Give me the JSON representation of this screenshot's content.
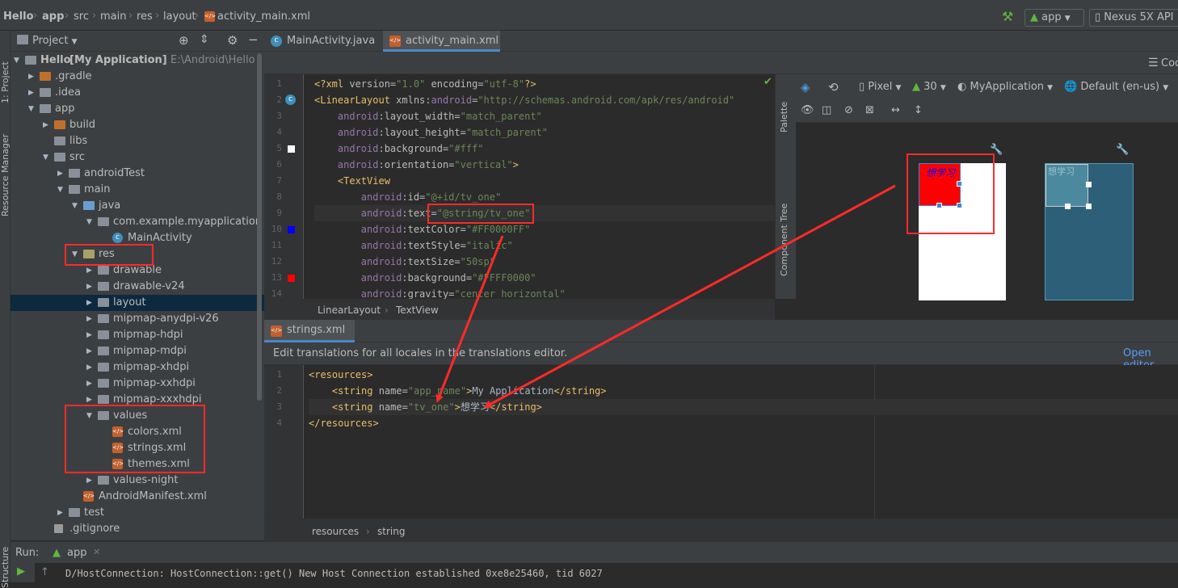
{
  "navbar": {
    "crumbs": [
      "Hello",
      "app",
      "src",
      "main",
      "res",
      "layout",
      "activity_main.xml"
    ],
    "run_config": "app",
    "device": "Nexus 5X API"
  },
  "left_stripe": {
    "project_label": "1: Project",
    "resource_manager_label": "Resource Manager",
    "structure_label": "Structure"
  },
  "project_panel": {
    "title": "Project",
    "tree": [
      {
        "label": "Hello",
        "extra": "[My Application]",
        "path": "E:\\Android\\Hello",
        "depth": 0,
        "arrow": "open",
        "icon": "folder"
      },
      {
        "label": ".gradle",
        "depth": 1,
        "arrow": "closed",
        "icon": "folder-orange"
      },
      {
        "label": ".idea",
        "depth": 1,
        "arrow": "closed",
        "icon": "folder"
      },
      {
        "label": "app",
        "depth": 1,
        "arrow": "open",
        "icon": "folder"
      },
      {
        "label": "build",
        "depth": 2,
        "arrow": "closed",
        "icon": "folder-orange"
      },
      {
        "label": "libs",
        "depth": 2,
        "arrow": "none",
        "icon": "folder"
      },
      {
        "label": "src",
        "depth": 2,
        "arrow": "open",
        "icon": "folder"
      },
      {
        "label": "androidTest",
        "depth": 3,
        "arrow": "closed",
        "icon": "folder"
      },
      {
        "label": "main",
        "depth": 3,
        "arrow": "open",
        "icon": "folder"
      },
      {
        "label": "java",
        "depth": 4,
        "arrow": "open",
        "icon": "folder-blue"
      },
      {
        "label": "com.example.myapplication",
        "depth": 5,
        "arrow": "open",
        "icon": "folder"
      },
      {
        "label": "MainActivity",
        "depth": 6,
        "arrow": "none",
        "icon": "class"
      },
      {
        "label": "res",
        "depth": 4,
        "arrow": "open",
        "icon": "folder-res"
      },
      {
        "label": "drawable",
        "depth": 5,
        "arrow": "closed",
        "icon": "folder"
      },
      {
        "label": "drawable-v24",
        "depth": 5,
        "arrow": "closed",
        "icon": "folder"
      },
      {
        "label": "layout",
        "depth": 5,
        "arrow": "closed",
        "icon": "folder",
        "selected": true
      },
      {
        "label": "mipmap-anydpi-v26",
        "depth": 5,
        "arrow": "closed",
        "icon": "folder"
      },
      {
        "label": "mipmap-hdpi",
        "depth": 5,
        "arrow": "closed",
        "icon": "folder"
      },
      {
        "label": "mipmap-mdpi",
        "depth": 5,
        "arrow": "closed",
        "icon": "folder"
      },
      {
        "label": "mipmap-xhdpi",
        "depth": 5,
        "arrow": "closed",
        "icon": "folder"
      },
      {
        "label": "mipmap-xxhdpi",
        "depth": 5,
        "arrow": "closed",
        "icon": "folder"
      },
      {
        "label": "mipmap-xxxhdpi",
        "depth": 5,
        "arrow": "closed",
        "icon": "folder"
      },
      {
        "label": "values",
        "depth": 5,
        "arrow": "open",
        "icon": "folder"
      },
      {
        "label": "colors.xml",
        "depth": 6,
        "arrow": "none",
        "icon": "xml"
      },
      {
        "label": "strings.xml",
        "depth": 6,
        "arrow": "none",
        "icon": "xml"
      },
      {
        "label": "themes.xml",
        "depth": 6,
        "arrow": "none",
        "icon": "xml"
      },
      {
        "label": "values-night",
        "depth": 5,
        "arrow": "closed",
        "icon": "folder"
      },
      {
        "label": "AndroidManifest.xml",
        "depth": 4,
        "arrow": "none",
        "icon": "manifest"
      },
      {
        "label": "test",
        "depth": 3,
        "arrow": "closed",
        "icon": "folder"
      },
      {
        "label": ".gitignore",
        "depth": 2,
        "arrow": "none",
        "icon": "file"
      }
    ]
  },
  "editor_tabs": [
    {
      "label": "MainActivity.java",
      "active": false,
      "icon": "class"
    },
    {
      "label": "activity_main.xml",
      "active": true,
      "icon": "xml"
    }
  ],
  "code_toggle_label": "Coc",
  "layout_code": {
    "lines": [
      {
        "n": "1",
        "parts": [
          [
            "kw",
            "<?xml "
          ],
          [
            "at",
            "version="
          ],
          [
            "sv",
            "\"1.0\" "
          ],
          [
            "at",
            "encoding="
          ],
          [
            "sv",
            "\"utf-8\""
          ],
          [
            "kw",
            "?>"
          ]
        ]
      },
      {
        "n": "2",
        "parts": [
          [
            "kw",
            "<LinearLayout "
          ],
          [
            "at",
            "xmlns:"
          ],
          [
            "ns",
            "android"
          ],
          [
            "at",
            "="
          ],
          [
            "sv",
            "\"http://schemas.android.com/apk/res/android\""
          ]
        ]
      },
      {
        "n": "3",
        "parts": [
          [
            "pl",
            "    "
          ],
          [
            "ns",
            "android"
          ],
          [
            "at",
            ":layout_width="
          ],
          [
            "sv",
            "\"match_parent\""
          ]
        ]
      },
      {
        "n": "4",
        "parts": [
          [
            "pl",
            "    "
          ],
          [
            "ns",
            "android"
          ],
          [
            "at",
            ":layout_height="
          ],
          [
            "sv",
            "\"match_parent\""
          ]
        ]
      },
      {
        "n": "5",
        "parts": [
          [
            "pl",
            "    "
          ],
          [
            "ns",
            "android"
          ],
          [
            "at",
            ":background="
          ],
          [
            "sv",
            "\"#fff\""
          ]
        ]
      },
      {
        "n": "6",
        "parts": [
          [
            "pl",
            "    "
          ],
          [
            "ns",
            "android"
          ],
          [
            "at",
            ":orientation="
          ],
          [
            "sv",
            "\"vertical\""
          ],
          [
            "kw",
            ">"
          ]
        ]
      },
      {
        "n": "7",
        "parts": [
          [
            "pl",
            "    "
          ],
          [
            "kw",
            "<TextView"
          ]
        ]
      },
      {
        "n": "8",
        "parts": [
          [
            "pl",
            "        "
          ],
          [
            "ns",
            "android"
          ],
          [
            "at",
            ":id="
          ],
          [
            "sv",
            "\"@+id/tv_one\""
          ]
        ]
      },
      {
        "n": "9",
        "parts": [
          [
            "pl",
            "        "
          ],
          [
            "ns",
            "android"
          ],
          [
            "at",
            ":text="
          ],
          [
            "sv",
            "\"@string/tv_one\""
          ]
        ]
      },
      {
        "n": "10",
        "parts": [
          [
            "pl",
            "        "
          ],
          [
            "ns",
            "android"
          ],
          [
            "at",
            ":textColor="
          ],
          [
            "sv",
            "\"#FF0000FF\""
          ]
        ]
      },
      {
        "n": "11",
        "parts": [
          [
            "pl",
            "        "
          ],
          [
            "ns",
            "android"
          ],
          [
            "at",
            ":textStyle="
          ],
          [
            "sv",
            "\"italic\""
          ]
        ]
      },
      {
        "n": "12",
        "parts": [
          [
            "pl",
            "        "
          ],
          [
            "ns",
            "android"
          ],
          [
            "at",
            ":textSize="
          ],
          [
            "sv",
            "\"50sp\""
          ]
        ]
      },
      {
        "n": "13",
        "parts": [
          [
            "pl",
            "        "
          ],
          [
            "ns",
            "android"
          ],
          [
            "at",
            ":background="
          ],
          [
            "sv",
            "\"#FFFF0000\""
          ]
        ]
      },
      {
        "n": "14",
        "parts": [
          [
            "pl",
            "        "
          ],
          [
            "ns",
            "android"
          ],
          [
            "at",
            ":gravity="
          ],
          [
            "sv",
            "\"center_horizontal\""
          ]
        ]
      }
    ],
    "breadcrumb": [
      "LinearLayout",
      "TextView"
    ]
  },
  "design_toolbar": {
    "device": "Pixel",
    "api": "30",
    "theme": "MyApplication",
    "locale": "Default (en-us)"
  },
  "side_tabs": {
    "palette": "Palette",
    "component_tree": "Component Tree"
  },
  "preview": {
    "text": "想学习",
    "blueprint_text": "想学习"
  },
  "strings_tab": {
    "label": "strings.xml"
  },
  "notification": {
    "text": "Edit translations for all locales in the translations editor.",
    "link": "Open editor"
  },
  "strings_code": {
    "lines": [
      {
        "n": "1",
        "parts": [
          [
            "kw",
            "<resources>"
          ]
        ]
      },
      {
        "n": "2",
        "parts": [
          [
            "pl",
            "    "
          ],
          [
            "kw",
            "<string "
          ],
          [
            "at",
            "name="
          ],
          [
            "sv",
            "\"app_name\""
          ],
          [
            "kw",
            ">"
          ],
          [
            "pl",
            "My Application"
          ],
          [
            "kw",
            "</string>"
          ]
        ]
      },
      {
        "n": "3",
        "parts": [
          [
            "pl",
            "    "
          ],
          [
            "kw",
            "<string "
          ],
          [
            "at",
            "name="
          ],
          [
            "sv",
            "\"tv_one\""
          ],
          [
            "kw",
            ">"
          ],
          [
            "pl",
            "想学习"
          ],
          [
            "kw",
            "</string>"
          ]
        ]
      },
      {
        "n": "4",
        "parts": [
          [
            "kw",
            "</resources>"
          ]
        ]
      }
    ],
    "breadcrumb": [
      "resources",
      "string"
    ]
  },
  "run_panel": {
    "label": "Run:",
    "config": "app",
    "log": "D/HostConnection: HostConnection::get() New Host Connection established 0xe8e25460, tid 6027"
  },
  "colors": {
    "annotation_red": "#ff2a2a",
    "preview_red": "#ff0000",
    "preview_text": "#0000ff",
    "blueprint": "#2d5f78"
  }
}
